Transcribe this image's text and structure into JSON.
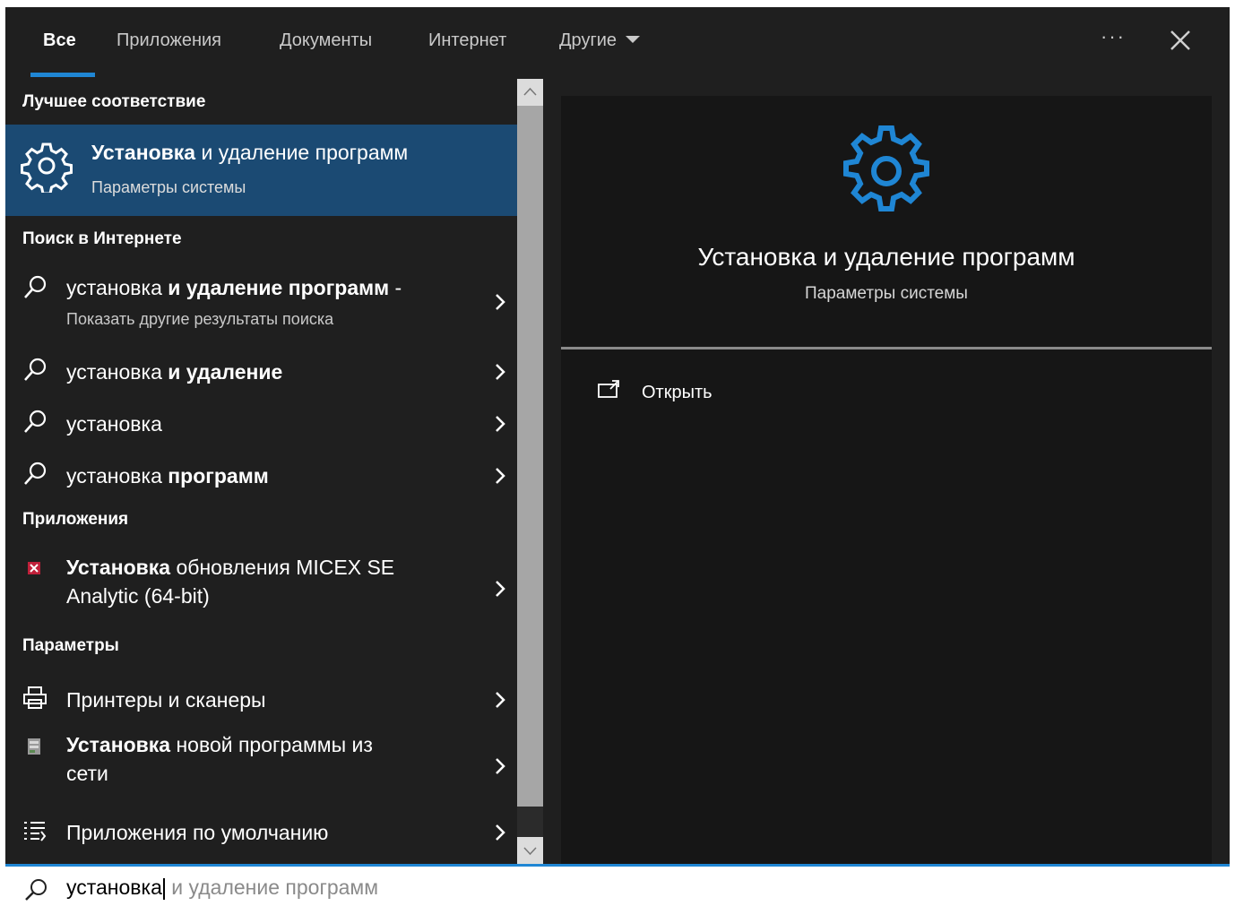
{
  "tabs": [
    {
      "label": "Все",
      "active": true
    },
    {
      "label": "Приложения"
    },
    {
      "label": "Документы"
    },
    {
      "label": "Интернет"
    },
    {
      "label": "Другие"
    }
  ],
  "more_label": "···",
  "sections": {
    "best_match": "Лучшее соответствие",
    "web_search": "Поиск в Интернете",
    "apps": "Приложения",
    "settings": "Параметры"
  },
  "best_match": {
    "title_bold": "Установка",
    "title_rest": " и удаление программ",
    "subtitle": "Параметры системы",
    "icon": "gear-icon"
  },
  "web_results": [
    {
      "normal": "установка ",
      "bold": "и удаление программ",
      "after": " -",
      "sub": "Показать другие результаты поиска"
    },
    {
      "normal": "установка ",
      "bold": "и удаление"
    },
    {
      "normal": "установка",
      "bold": ""
    },
    {
      "normal": "установка ",
      "bold": "программ"
    }
  ],
  "app_results": [
    {
      "bold": "Установка",
      "rest": " обновления MICEX SE",
      "line2": "Analytic (64-bit)",
      "icon": "micex-app-icon"
    }
  ],
  "settings_results": [
    {
      "bold": "",
      "rest": "Принтеры и сканеры",
      "icon": "printer-icon"
    },
    {
      "bold": "Установка",
      "rest": " новой программы из",
      "line2": "сети",
      "icon": "network-install-icon"
    },
    {
      "bold": "",
      "rest": "Приложения по умолчанию",
      "icon": "default-apps-icon"
    }
  ],
  "preview": {
    "title": "Установка и удаление программ",
    "subtitle": "Параметры системы",
    "action_label": "Открыть",
    "accent": "#1f86d4"
  },
  "search": {
    "typed": "установка",
    "suggestion": " и удаление программ"
  },
  "colors": {
    "accent": "#1f86d4",
    "selected_bg": "#1b4a73",
    "panel_bg": "#1f1f1f",
    "preview_bg": "#161616"
  }
}
